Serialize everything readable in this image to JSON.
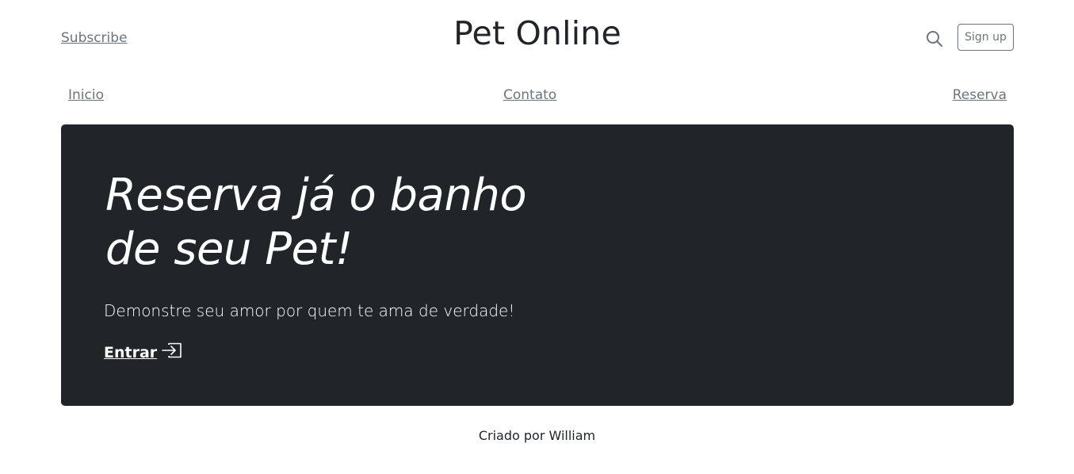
{
  "header": {
    "subscribe_label": "Subscribe",
    "brand": "Pet Online",
    "signup_label": "Sign up"
  },
  "nav": {
    "items": [
      {
        "label": "Inicio"
      },
      {
        "label": "Contato"
      },
      {
        "label": "Reserva"
      }
    ]
  },
  "hero": {
    "title_line1": "Reserva já o banho",
    "title_line2": "de seu Pet!",
    "lead": "Demonstre seu amor por quem te ama de verdade!",
    "link_label": "Entrar"
  },
  "footer": {
    "text": "Criado por William"
  },
  "colors": {
    "hero_bg": "#212529",
    "muted": "#6c757d",
    "text": "#212529"
  },
  "icons": {
    "search": "search-icon",
    "enter": "box-arrow-in-right-icon"
  }
}
